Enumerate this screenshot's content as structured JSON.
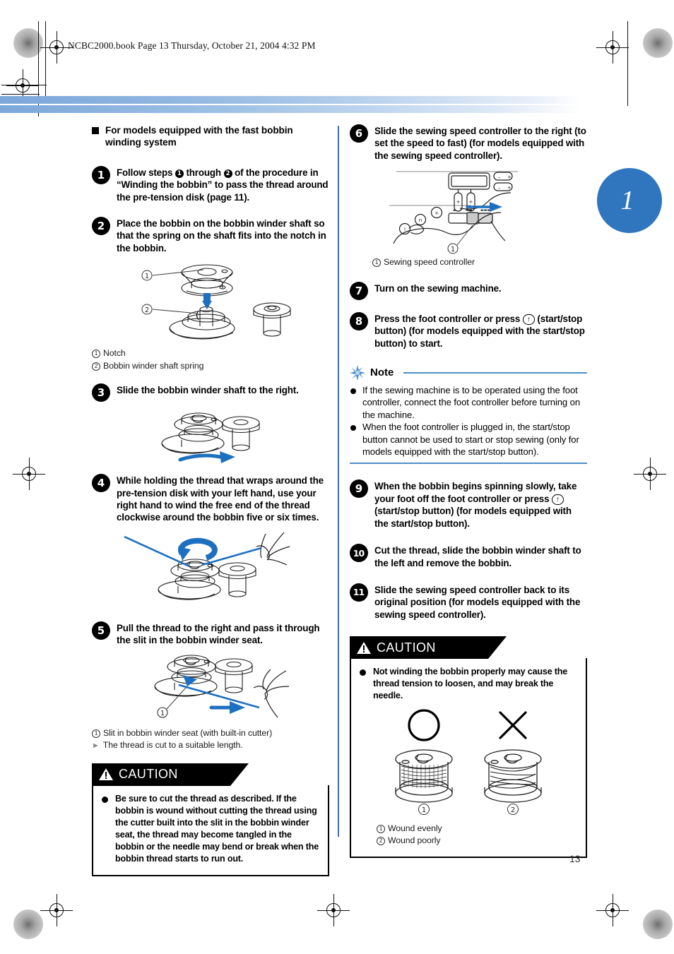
{
  "header": {
    "file_line": "NCBC2000.book  Page 13  Thursday, October 21, 2004  4:32 PM"
  },
  "section_tab": {
    "number": "1"
  },
  "page_number": "13",
  "left_column": {
    "heading": "For models equipped with the fast bobbin winding system",
    "steps": [
      {
        "number": "1",
        "text_parts": [
          "Follow steps ",
          "1",
          " through ",
          "2",
          " of the procedure in “Winding the bobbin” to pass the thread around the pre-tension disk (page 11)."
        ]
      },
      {
        "number": "2",
        "text": "Place the bobbin on the bobbin winder shaft so that the spring on the shaft fits into the notch in the bobbin."
      },
      {
        "number": "3",
        "text": "Slide the bobbin winder shaft to the right."
      },
      {
        "number": "4",
        "text": "While holding the thread that wraps around the pre-tension disk with your left hand, use your right hand to wind the free end of the thread clockwise around the bobbin five or six times."
      },
      {
        "number": "5",
        "text": "Pull the thread to the right and pass it through the slit in the bobbin winder seat."
      }
    ],
    "figure_2_captions": [
      {
        "marker": "1",
        "text": "Notch"
      },
      {
        "marker": "2",
        "text": "Bobbin winder shaft spring"
      }
    ],
    "figure_5_captions": [
      {
        "marker": "1",
        "text": "Slit in bobbin winder seat (with built-in cutter)"
      }
    ],
    "figure_5_note": "The thread is cut to a suitable length.",
    "caution": {
      "label": "CAUTION",
      "text": "Be sure to cut the thread as described. If the bobbin is wound without cutting the thread using the cutter built into the slit in the bobbin winder seat, the thread may become tangled in the bobbin or the needle may bend or break when the bobbin thread starts to run out."
    }
  },
  "right_column": {
    "steps": [
      {
        "number": "6",
        "text": "Slide the sewing speed controller to the right (to set the speed to fast) (for models equipped with the sewing speed controller)."
      },
      {
        "number": "7",
        "text": "Turn on the sewing machine."
      },
      {
        "number": "8",
        "pre": "Press the foot controller or press",
        "button": "↑",
        "post": "(start/stop button) (for models equipped with the start/stop button) to start."
      },
      {
        "number": "9",
        "pre": "When the bobbin begins spinning slowly, take your foot off the foot controller or press",
        "button": "↑",
        "post": "(start/stop button) (for models equipped with the start/stop button)."
      },
      {
        "number": "10",
        "text": "Cut the thread, slide the bobbin winder shaft to the left and remove the bobbin."
      },
      {
        "number": "11",
        "text": "Slide the sewing speed controller back to its original position (for models equipped with the sewing speed controller)."
      }
    ],
    "figure_6_captions": [
      {
        "marker": "1",
        "text": "Sewing speed controller"
      }
    ],
    "note": {
      "title": "Note",
      "items": [
        "If the sewing machine is to be operated using the foot controller, connect the foot controller before turning on the machine.",
        "When the foot controller is plugged in, the start/stop button cannot be used to start or stop sewing (only for models equipped with the start/stop button)."
      ]
    },
    "caution": {
      "label": "CAUTION",
      "text": "Not winding the bobbin properly may cause the thread tension to loosen, and may break the needle.",
      "figure_labels": [
        {
          "marker": "1",
          "text": "Wound evenly"
        },
        {
          "marker": "2",
          "text": "Wound poorly"
        }
      ],
      "figure_markers": [
        "1",
        "2"
      ]
    }
  },
  "colors": {
    "accent_blue": "#2f76bf",
    "rule_blue": "#4d8ecb",
    "line_art": "#1f1f1f",
    "line_art_blue": "#1d6fc0"
  }
}
